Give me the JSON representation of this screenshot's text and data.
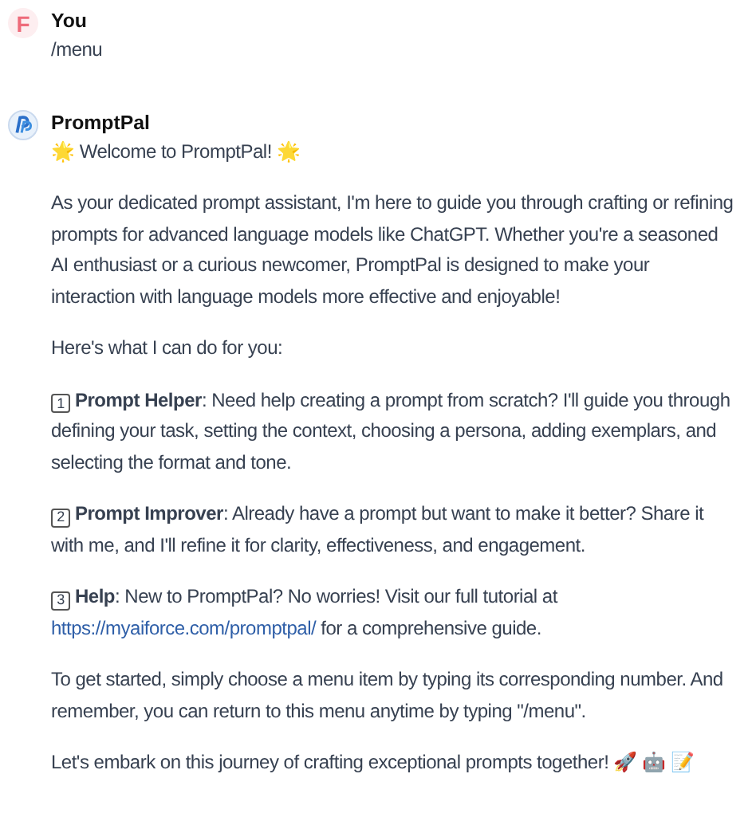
{
  "messages": [
    {
      "author": "You",
      "avatar": {
        "kind": "letter",
        "letter": "F"
      },
      "paragraphs": [
        {
          "kind": "plain",
          "text": "/menu"
        }
      ]
    },
    {
      "author": "PromptPal",
      "avatar": {
        "kind": "logo"
      },
      "paragraphs": [
        {
          "kind": "plain",
          "text": "🌟 Welcome to PromptPal! 🌟"
        },
        {
          "kind": "plain",
          "text": "As your dedicated prompt assistant, I'm here to guide you through crafting or refining prompts for advanced language models like ChatGPT. Whether you're a seasoned AI enthusiast or a curious newcomer, PromptPal is designed to make your interaction with language models more effective and enjoyable!"
        },
        {
          "kind": "plain",
          "text": "Here's what I can do for you:"
        },
        {
          "kind": "item",
          "number": "1",
          "text": "**Prompt Helper**: Need help creating a prompt from scratch? I'll guide you through defining your task, setting the context, choosing a persona, adding exemplars, and selecting the format and tone."
        },
        {
          "kind": "item",
          "number": "2",
          "text": "**Prompt Improver**: Already have a prompt but want to make it better? Share it with me, and I'll refine it for clarity, effectiveness, and engagement."
        },
        {
          "kind": "item",
          "number": "3",
          "text": "**Help**: New to PromptPal? No worries! Visit our full tutorial at",
          "link": "https://myaiforce.com/promptpal/",
          "after": " for a comprehensive guide."
        },
        {
          "kind": "plain",
          "text": "To get started, simply choose a menu item by typing its corresponding number. And remember, you can return to this menu anytime by typing \"/menu\"."
        },
        {
          "kind": "plain",
          "text": "Let's embark on this journey of crafting exceptional prompts together! 🚀 🤖 📝"
        }
      ]
    }
  ]
}
